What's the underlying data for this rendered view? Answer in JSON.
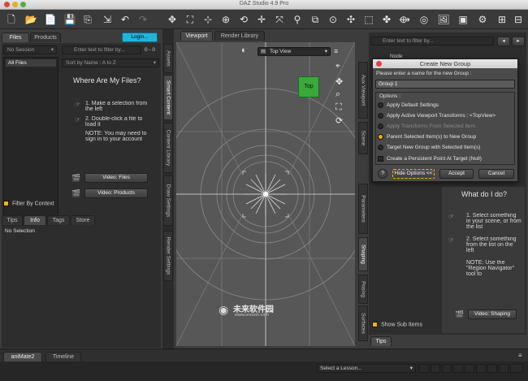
{
  "window": {
    "title": "DAZ Studio 4.9 Pro"
  },
  "toolbar_icons": [
    "new-file-icon",
    "open-folder-icon",
    "open-file-icon",
    "save-icon",
    "merge-icon",
    "import-icon",
    "undo-icon",
    "redo-icon",
    "scene-tool-icon",
    "transform-tool-icon",
    "node-select-icon",
    "universal-tool-icon",
    "rotate-tool-icon",
    "translate-tool-icon",
    "scale-tool-icon",
    "joint-editor-icon",
    "move-icon",
    "tool-icon",
    "active-pose-icon",
    "spot-render-icon",
    "render-icon",
    "render-settings-icon",
    "panel-icon",
    "panel-icon",
    "panel-icon"
  ],
  "left": {
    "tabs": [
      "Files",
      "Products"
    ],
    "login": "Login...",
    "no_session": "No Session",
    "search_placeholder": "Enter text to filter by...",
    "count": "0 - 0",
    "sort": "Sort by Name : A to Z",
    "all_files": "All Files",
    "help_title": "Where Are My Files?",
    "step1": "1. Make a selection from the left",
    "step2": "2. Double-click a file to load it",
    "note": "NOTE: You may need to sign in to your account",
    "video_files": "Video: Files",
    "video_products": "Video: Products",
    "filter_by_context": "Filter By Context",
    "vtabs": [
      "Smart Content",
      "Content Library",
      "Draw Settings",
      "Render Settings"
    ],
    "assets_tab": "Assets",
    "bottom_tabs": [
      "Tips",
      "Info",
      "Tags",
      "Store"
    ],
    "no_selection": "No Selection"
  },
  "viewport": {
    "tabs": [
      "Viewport",
      "Render Library"
    ],
    "view": "Top View",
    "cube_label": "Top",
    "watermark_cn": "未来软件园",
    "watermark_url": "www.orsoon.com"
  },
  "right": {
    "search_placeholder": "Enter text to filter by...",
    "node_header": "Node",
    "vtabs_left": [
      "Aux Viewport",
      "Scene",
      "Parameters",
      "Shaping",
      "Posing",
      "Surfaces"
    ],
    "help_title": "What do I do?",
    "step1": "1. Select something in your scene, or from the list",
    "step2": "2. Select something from the list on the left",
    "note": "NOTE: Use the \"Region Navigator\" tool to",
    "video_shaping": "Video: Shaping",
    "show_sub_items": "Show Sub Items",
    "tips_tab": "Tips"
  },
  "dialog": {
    "title": "Create New Group",
    "prompt": "Please enter a name for the new Group :",
    "name_value": "Group 1",
    "options_label": "Options :",
    "options": [
      {
        "label": "Apply Default Settings",
        "selected": false
      },
      {
        "label": "Apply Active Viewport Transforms : <TopView>",
        "selected": false
      },
      {
        "label": "Apply Transforms From Selected Item",
        "selected": false
      },
      {
        "label": "Parent Selected Item(s) to New Group",
        "selected": true
      },
      {
        "label": "Target New Group with Selected Item(s)",
        "selected": false
      }
    ],
    "persistent_point": "Create a Persistent Point At Target (Null)",
    "hide_options": "Hide Options <<",
    "accept": "Accept",
    "cancel": "Cancel",
    "help": "?"
  },
  "bottom": {
    "tabs": [
      "aniMate2",
      "Timeline"
    ],
    "lesson": "Select a Lesson..."
  },
  "colors": {
    "accent_login": "#1fb6d8",
    "cube_green": "#3aa83a",
    "radio_on": "#f0b400",
    "close_red": "#e0443e",
    "min_yellow": "#e2b022",
    "max_green": "#4fb13d"
  }
}
